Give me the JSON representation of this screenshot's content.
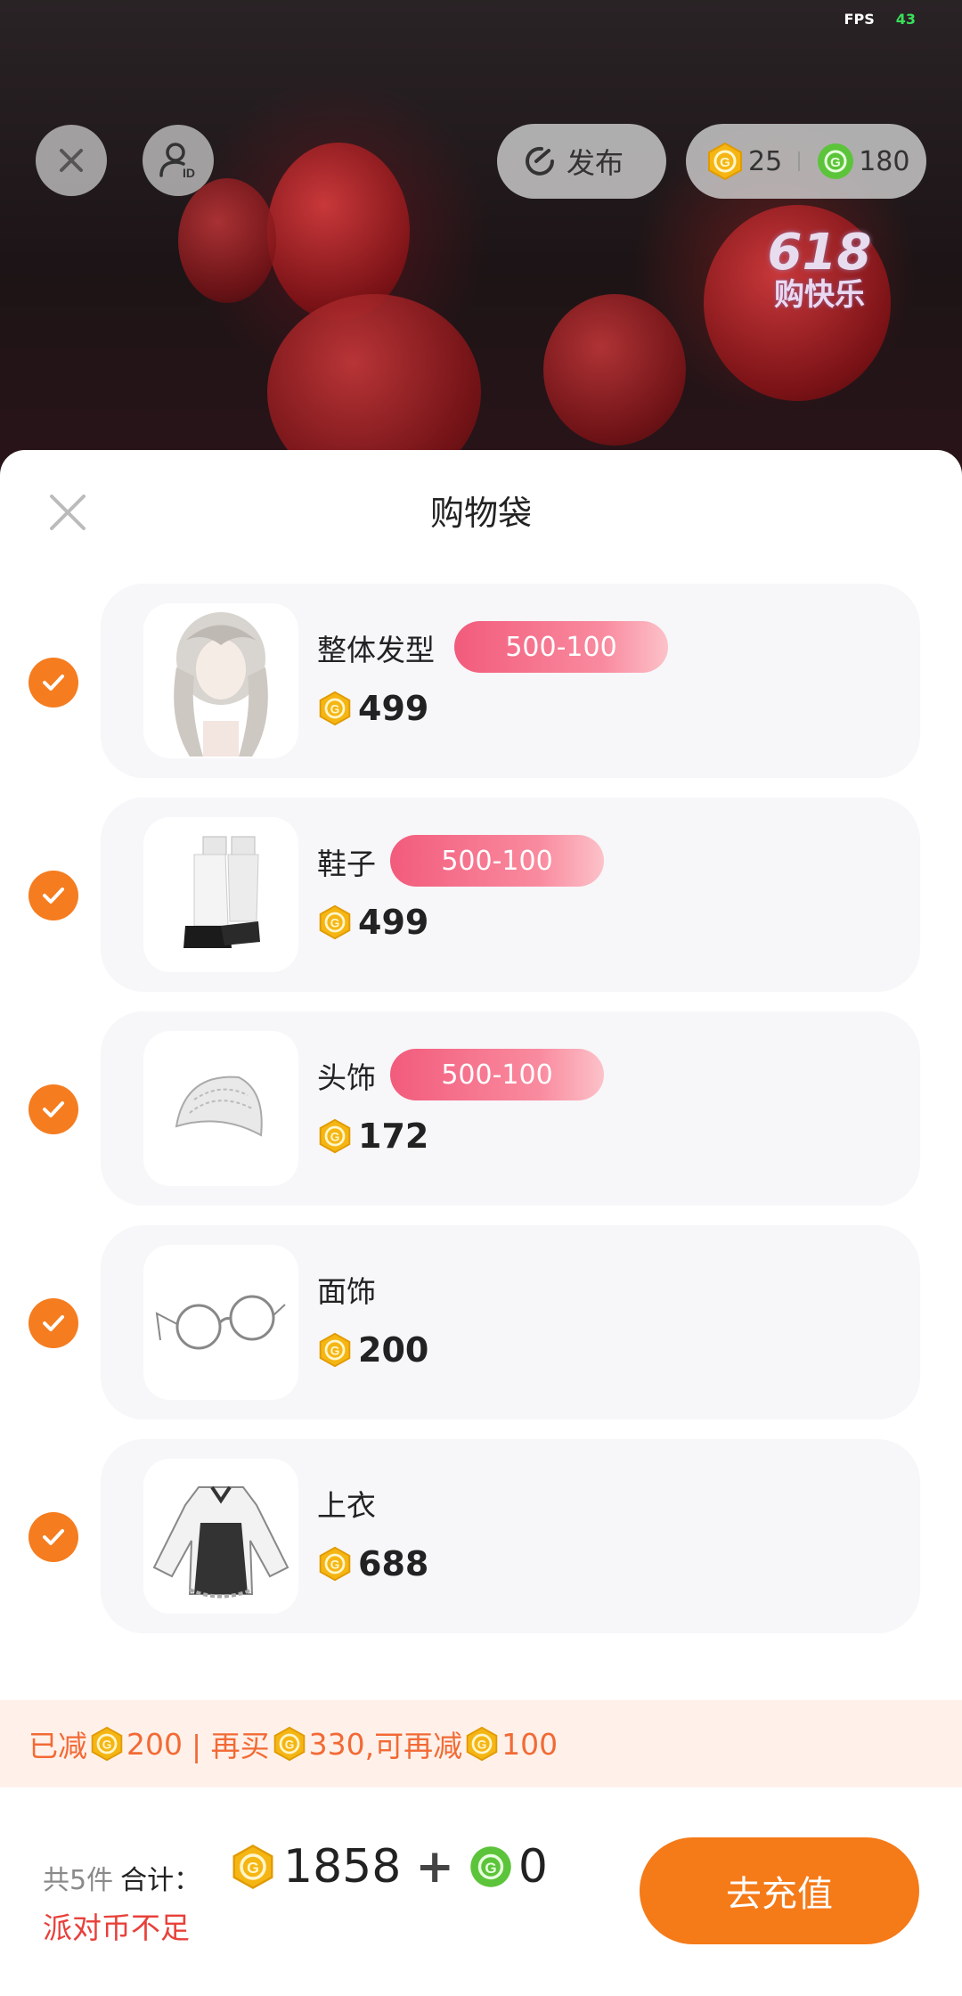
{
  "hud": {
    "fps_label": "FPS",
    "fps_value": "43",
    "publish_label": "发布",
    "gold_coins": "25",
    "green_coins": "180",
    "event_badge_line1": "618",
    "event_badge_line2": "购快乐"
  },
  "sheet": {
    "title": "购物袋",
    "items": [
      {
        "name": "整体发型",
        "promo": "500-100",
        "price": "499",
        "checked": true,
        "icon": "hairstyle-icon"
      },
      {
        "name": "鞋子",
        "promo": "500-100",
        "price": "499",
        "checked": true,
        "icon": "shoes-icon"
      },
      {
        "name": "头饰",
        "promo": "500-100",
        "price": "172",
        "checked": true,
        "icon": "headwear-icon"
      },
      {
        "name": "面饰",
        "promo": "",
        "price": "200",
        "checked": true,
        "icon": "glasses-icon"
      },
      {
        "name": "上衣",
        "promo": "",
        "price": "688",
        "checked": true,
        "icon": "top-icon"
      }
    ]
  },
  "discount": {
    "reduced_label": "已减",
    "reduced_amount": "200",
    "separator": "| 再买",
    "buy_more_amount": "330",
    "can_reduce_label": ",可再减",
    "can_reduce_amount": "100"
  },
  "footer": {
    "count_label": "共5件",
    "total_label": "合计：",
    "total_gold": "1858",
    "plus": "+",
    "total_green": "0",
    "warning": "派对币不足",
    "recharge_label": "去充值"
  },
  "colors": {
    "accent_orange": "#f57a18",
    "coin_gold": "#f5b614",
    "coin_green": "#5cc43a",
    "promo_pink": "#f25b7c",
    "warning_red": "#e8403a"
  }
}
